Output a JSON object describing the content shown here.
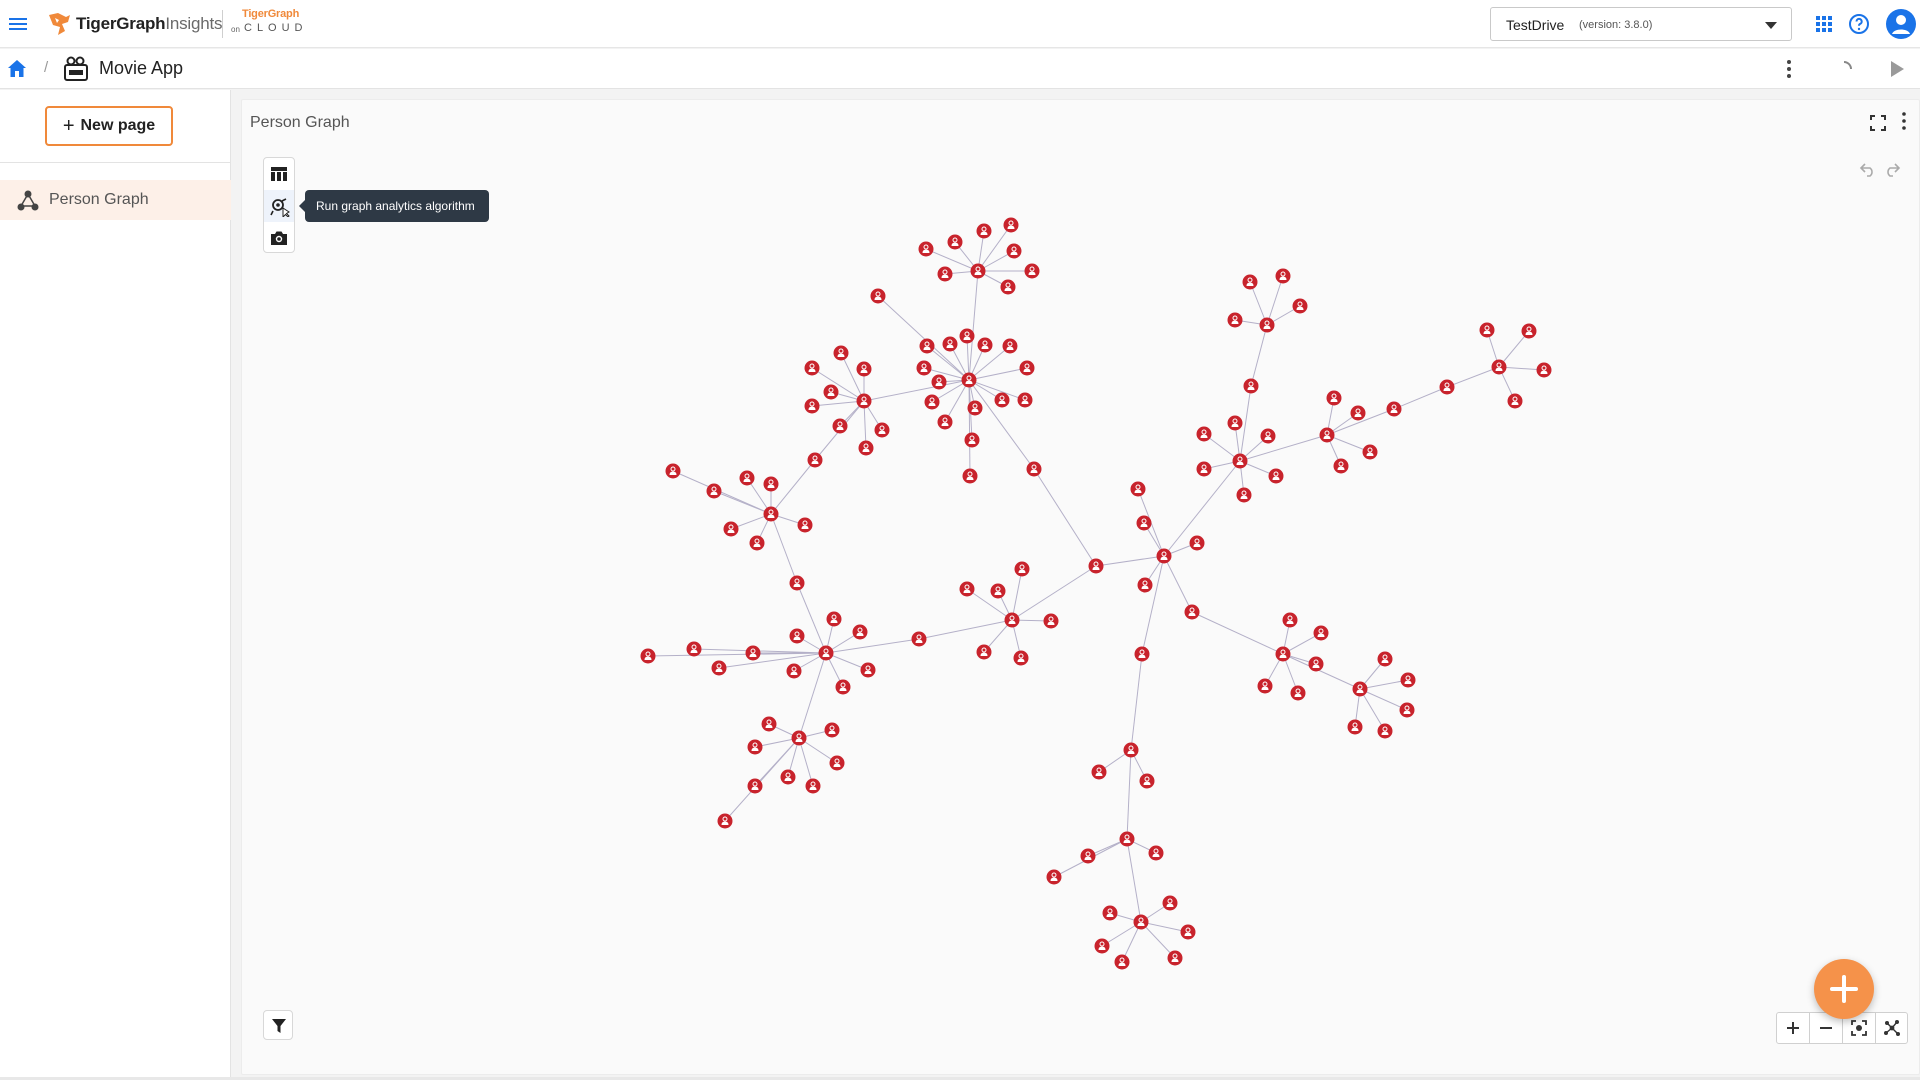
{
  "header": {
    "brand_name": "TigerGraph",
    "brand_product": "Insights",
    "cloud_brand_top": "TigerGraph",
    "cloud_brand_on": "on",
    "cloud_brand_cloud": "CLOUD",
    "workspace": {
      "name": "TestDrive",
      "version": "(version: 3.8.0)"
    }
  },
  "breadcrumb": {
    "separator": "/",
    "app_title": "Movie App"
  },
  "sidebar": {
    "new_page_label": "New page",
    "new_page_plus": "+",
    "pages": [
      {
        "label": "Person Graph",
        "selected": true
      }
    ]
  },
  "panel": {
    "title": "Person Graph",
    "tooltip": "Run graph analytics algorithm",
    "toolbar": [
      "table-icon",
      "graph-analytics-icon",
      "camera-icon"
    ]
  },
  "graph": {
    "node_color": "#c8232c",
    "edge_color": "#b4b0c8",
    "node_type": "Person",
    "node_count": 153
  },
  "colors": {
    "accent": "#f0893a",
    "fab": "#f5924a",
    "tooltip_bg": "#2e3945",
    "selected_item_bg": "#fdf0e8",
    "profile": "#1a73e8"
  }
}
